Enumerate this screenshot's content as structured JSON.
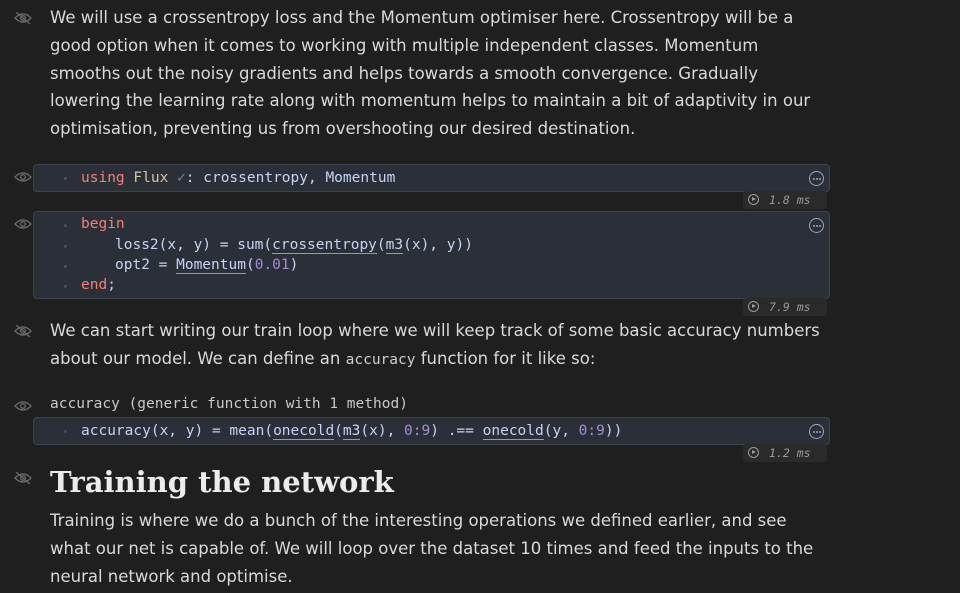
{
  "md1": "We will use a crossentropy loss and the Momentum optimiser here. Crossentropy will be a good option when it comes to working with multiple independent classes. Momentum smooths out the noisy gradients and helps towards a smooth convergence. Gradually lowering the learning rate along with momentum helps to maintain a bit of adaptivity in our optimisation, preventing us from overshooting our desired destination.",
  "cell1": {
    "kw": "using",
    "module": "Flux",
    "check": "✓",
    "rest": ": crossentropy, Momentum",
    "time": "1.8 ms"
  },
  "cell2": {
    "begin": "begin",
    "l2_a": "loss2(x, y) = sum(",
    "l2_ce": "crossentropy",
    "l2_b": "(",
    "l2_m3": "m3",
    "l2_c": "(x), y))",
    "l3_a": "opt2 = ",
    "l3_mom": "Momentum",
    "l3_b": "(",
    "l3_num": "0.01",
    "l3_c": ")",
    "end": "end",
    "semi": ";",
    "time": "7.9 ms"
  },
  "md2_a": "We can start writing our train loop where we will keep track of some basic accuracy numbers about our model. We can define an ",
  "md2_code": "accuracy",
  "md2_b": " function for it like so:",
  "cell3": {
    "output": "accuracy (generic function with 1 method)",
    "c1": "accuracy(x, y) = mean(",
    "oc1": "onecold",
    "c2": "(",
    "m3": "m3",
    "c3": "(x), ",
    "r1": "0:9",
    "c4": ") .== ",
    "oc2": "onecold",
    "c5": "(y, ",
    "r2": "0:9",
    "c6": "))",
    "time": "1.2 ms"
  },
  "heading": "Training the network",
  "md3": "Training is where we do a bunch of the interesting operations we defined earlier, and see what our net is capable of. We will loop over the dataset 10 times and feed the inputs to the neural network and optimise."
}
